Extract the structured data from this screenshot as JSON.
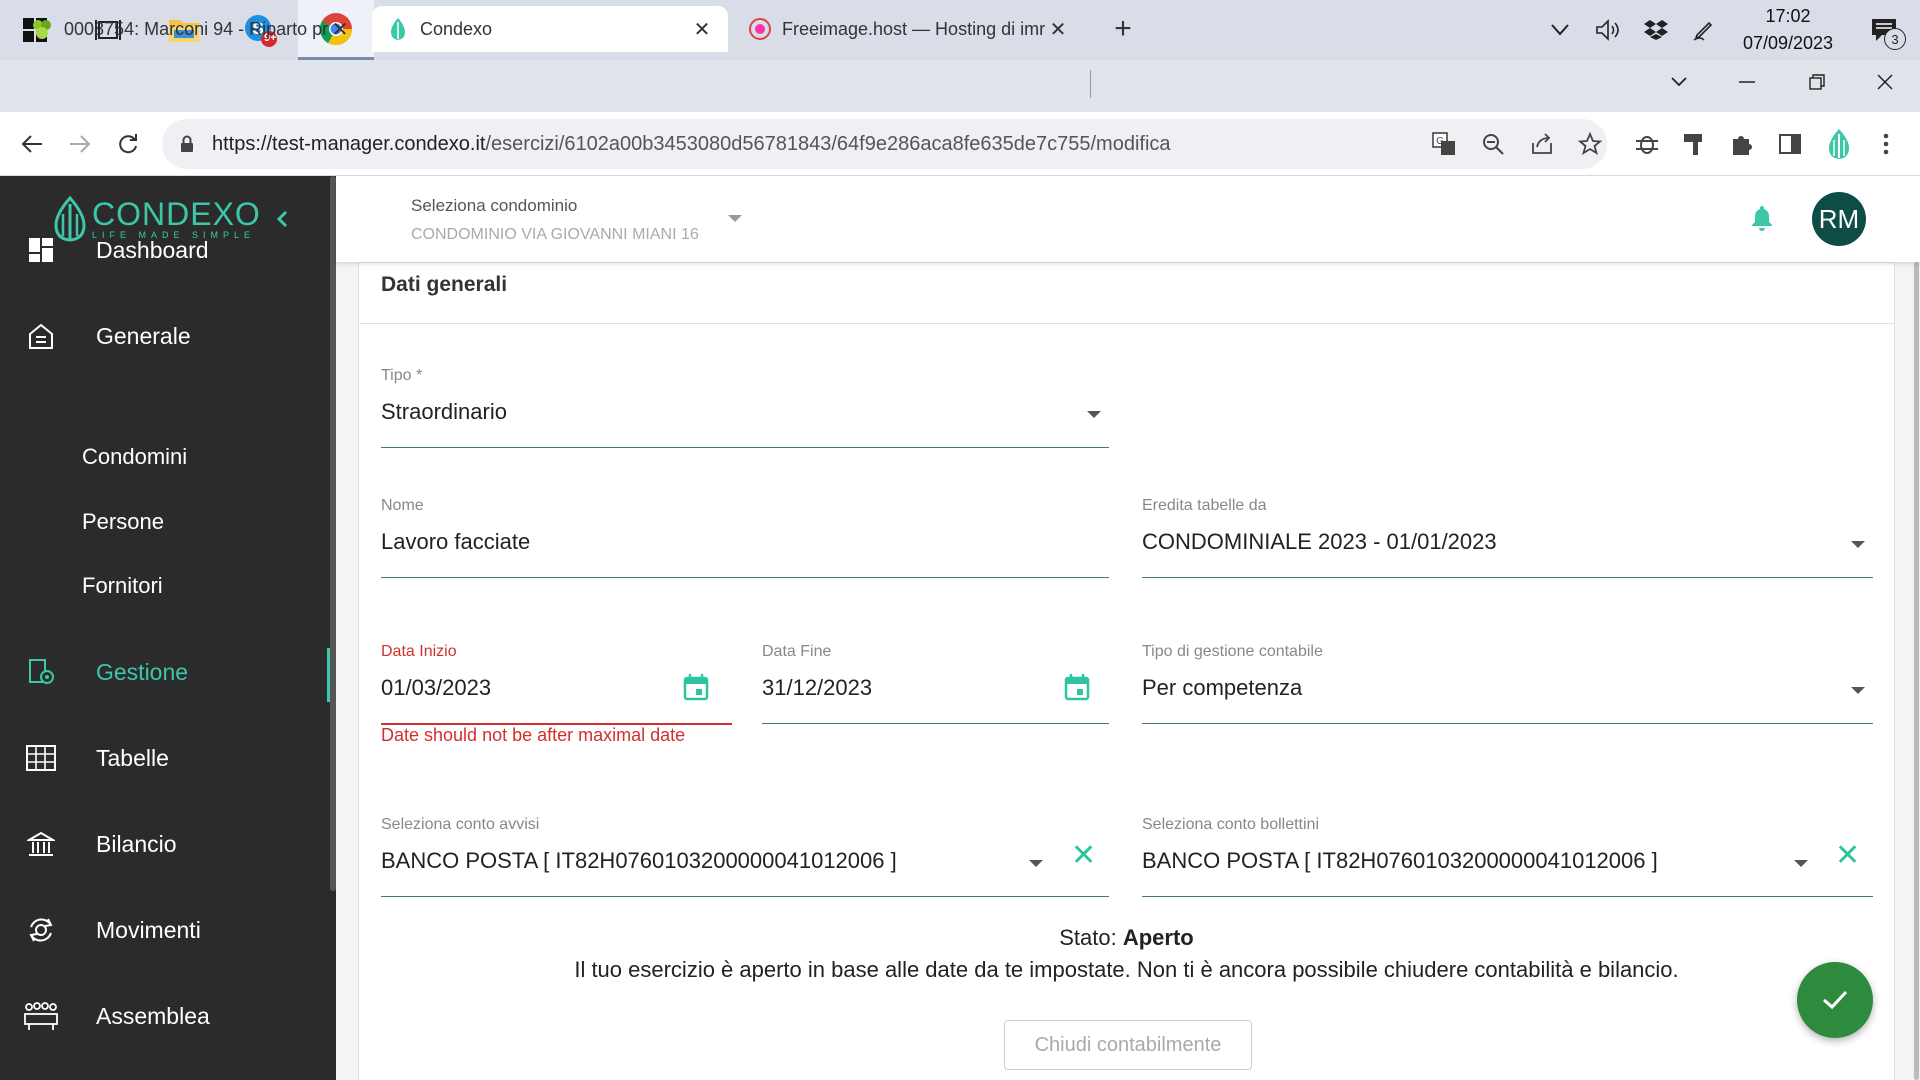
{
  "taskbar": {
    "clock_time": "17:02",
    "clock_date": "07/09/2023",
    "notification_count": "3",
    "skype_badge": "9+"
  },
  "browser": {
    "tabs": [
      {
        "title": "0008754: Marconi 94 - Riparto pr"
      },
      {
        "title": "Condexo"
      },
      {
        "title": "Freeimage.host — Hosting di imr"
      }
    ],
    "url_host": "https://test-manager.condexo.it",
    "url_path": "/esercizi/6102a00b3453080d56781843/64f9e286aca8fe635de7c755/modifica"
  },
  "sidebar": {
    "logo_word": "CONDEXO",
    "logo_tagline": "LIFE MADE SIMPLE",
    "items": [
      {
        "label": "Dashboard"
      },
      {
        "label": "Generale"
      },
      {
        "label": "Condomini"
      },
      {
        "label": "Persone"
      },
      {
        "label": "Fornitori"
      },
      {
        "label": "Gestione"
      },
      {
        "label": "Tabelle"
      },
      {
        "label": "Bilancio"
      },
      {
        "label": "Movimenti"
      },
      {
        "label": "Assemblea"
      }
    ],
    "active_item": "Gestione"
  },
  "header": {
    "condominio_label": "Seleziona condominio",
    "condominio_value": "CONDOMINIO VIA GIOVANNI MIANI 16",
    "avatar_initials": "RM"
  },
  "form": {
    "section_title": "Dati generali",
    "tipo": {
      "label": "Tipo *",
      "value": "Straordinario"
    },
    "nome": {
      "label": "Nome",
      "value": "Lavoro facciate"
    },
    "eredita": {
      "label": "Eredita tabelle da",
      "value": "CONDOMINIALE 2023 - 01/01/2023"
    },
    "data_inizio": {
      "label": "Data Inizio",
      "value": "01/03/2023",
      "error": "Date should not be after maximal date"
    },
    "data_fine": {
      "label": "Data Fine",
      "value": "31/12/2023"
    },
    "gestione": {
      "label": "Tipo di gestione contabile",
      "value": "Per competenza"
    },
    "conto_avvisi": {
      "label": "Seleziona conto avvisi",
      "value": "BANCO POSTA [ IT82H0760103200000041012006 ]"
    },
    "conto_bollettini": {
      "label": "Seleziona conto bollettini",
      "value": "BANCO POSTA [ IT82H0760103200000041012006 ]"
    }
  },
  "status": {
    "prefix": "Stato:",
    "value": "Aperto",
    "message": "Il tuo esercizio è aperto in base alle date da te impostate. Non ti è ancora possibile chiudere contabilità e bilancio.",
    "close_button": "Chiudi contabilmente"
  },
  "colors": {
    "accent": "#3cc8a8",
    "sidebar_bg": "#2b2b2b",
    "error": "#d32f2f",
    "fab": "#2e8b3e",
    "avatar": "#0e4d45"
  }
}
